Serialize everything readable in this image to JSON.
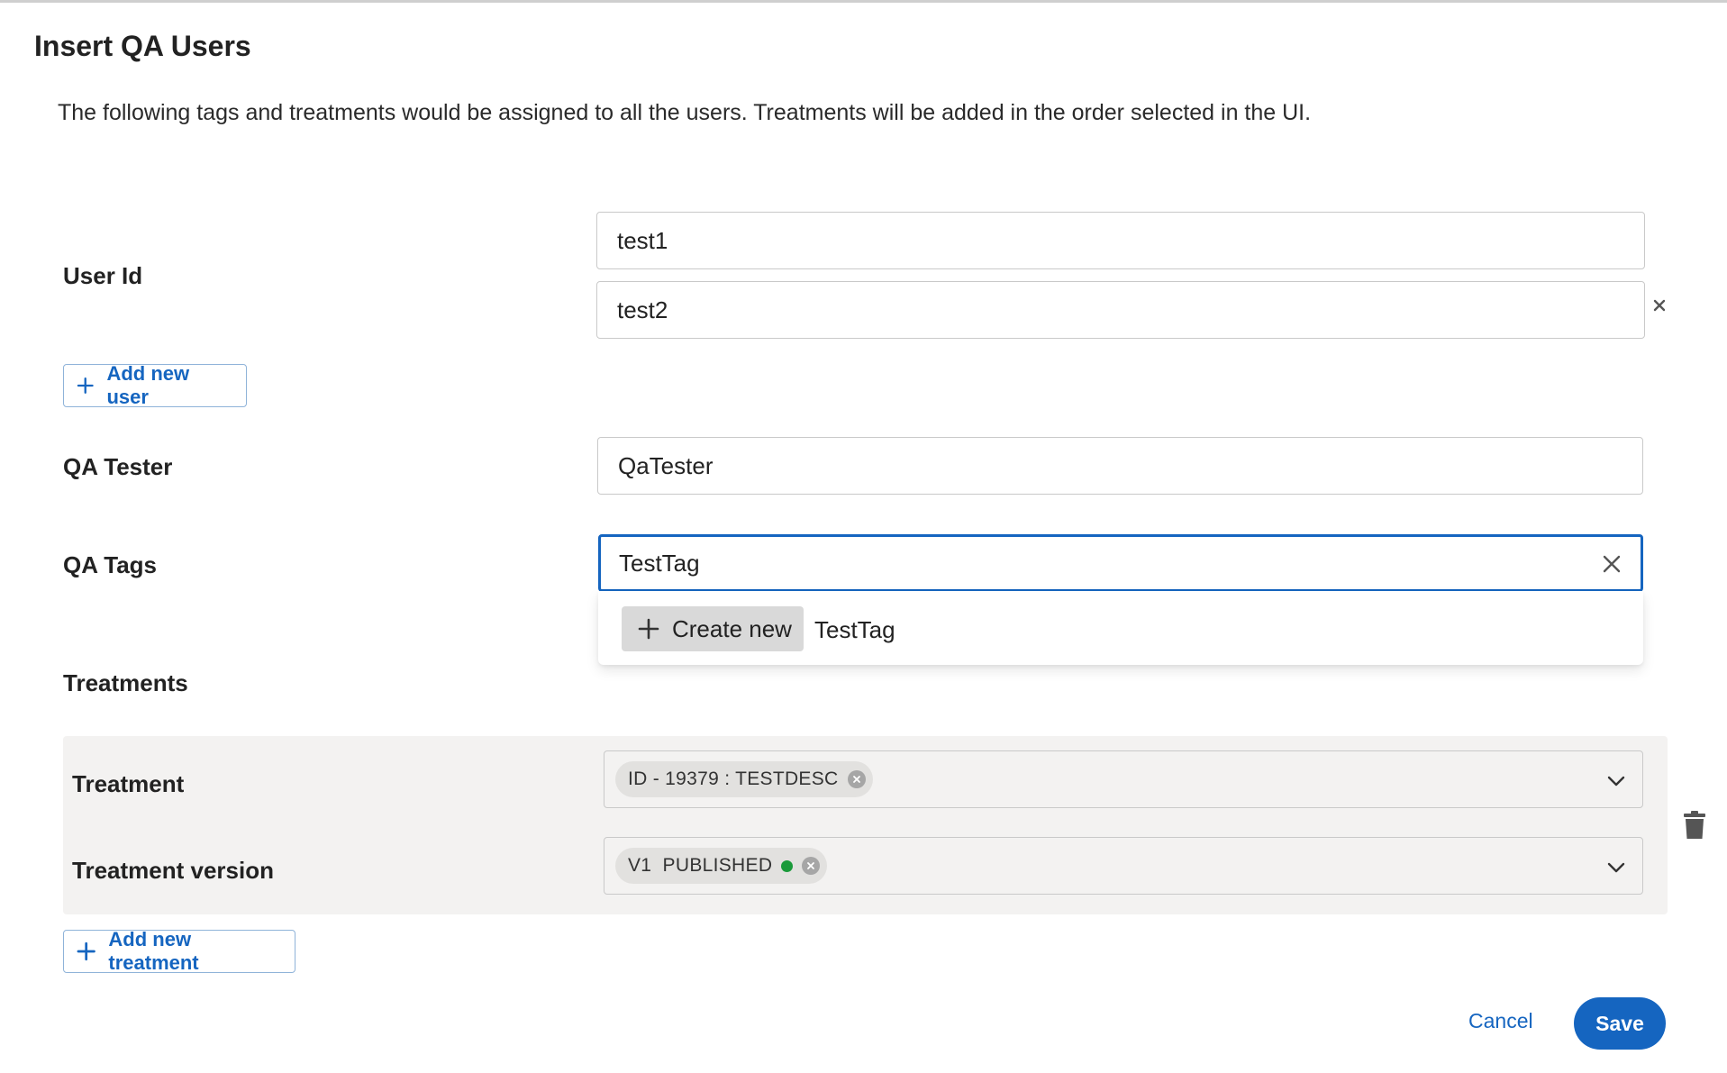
{
  "dialog": {
    "title": "Insert QA Users",
    "description": "The following tags and treatments would be assigned to all the users. Treatments will be added in the order selected in the UI."
  },
  "user_id": {
    "label": "User Id",
    "values": [
      "test1",
      "test2"
    ],
    "add_button": "Add new user"
  },
  "qa_tester": {
    "label": "QA Tester",
    "value": "QaTester"
  },
  "qa_tags": {
    "label": "QA Tags",
    "value": "TestTag",
    "dropdown": {
      "create_label": "Create new",
      "create_value": "TestTag"
    }
  },
  "treatments": {
    "section_label": "Treatments",
    "treatment_label": "Treatment",
    "treatment_value": "ID - 19379 : TESTDESC",
    "version_label": "Treatment version",
    "version_value": "V1  PUBLISHED",
    "version_status_color": "#1a9a3a",
    "add_button": "Add new treatment"
  },
  "footer": {
    "cancel": "Cancel",
    "save": "Save"
  },
  "icons": [
    "plus-icon",
    "close-icon",
    "clear-icon",
    "chevron-down-icon",
    "trash-icon",
    "remove-chip-icon"
  ],
  "colors": {
    "accent": "#1565c0",
    "panel_bg": "#f3f2f1"
  }
}
